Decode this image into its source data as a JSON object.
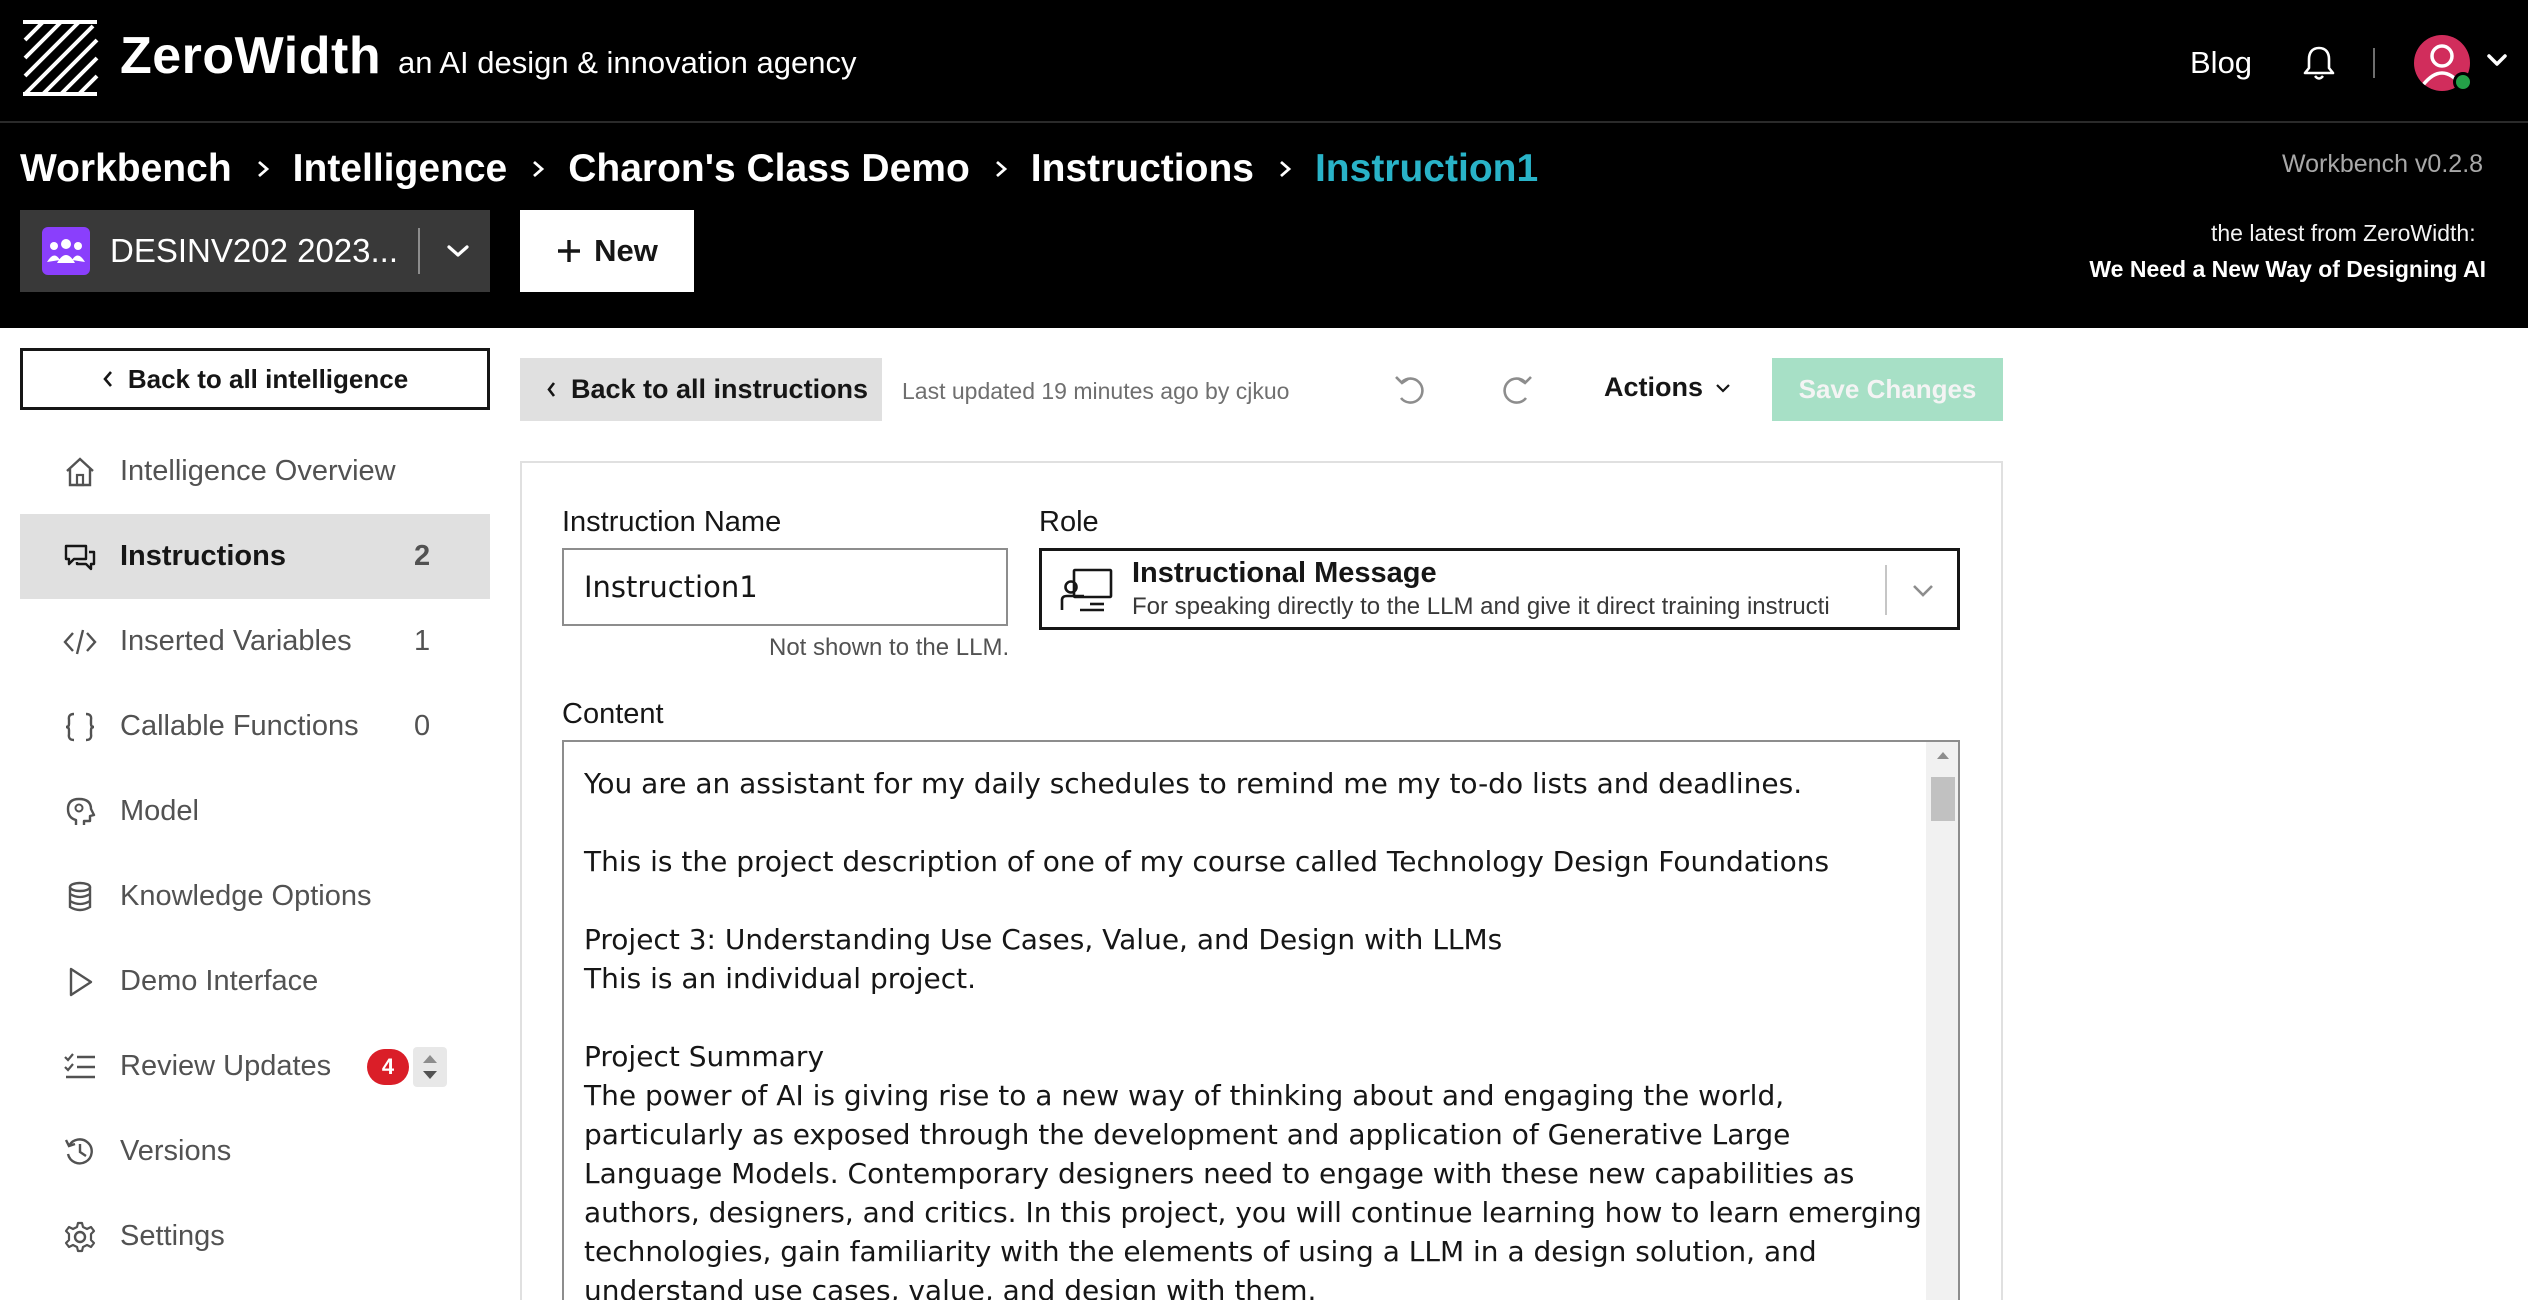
{
  "header": {
    "brand_name": "ZeroWidth",
    "tagline": "an AI design & innovation agency",
    "blog_label": "Blog",
    "icons": {
      "logo": "zerowidth-logo-icon",
      "notifications": "bell-icon",
      "user": "user-avatar-icon",
      "menu": "chevron-down-icon"
    }
  },
  "breadcrumb": {
    "items": [
      "Workbench",
      "Intelligence",
      "Charon's Class Demo",
      "Instructions",
      "Instruction1"
    ]
  },
  "version_label": "Workbench v0.2.8",
  "latest": {
    "label": "the latest from ZeroWidth:",
    "article": "We Need a New Way of Designing AI"
  },
  "org_selector": {
    "label": "DESINV202 2023..."
  },
  "new_button": {
    "label": "New"
  },
  "sidebar": {
    "back_label": "Back to all intelligence",
    "items": [
      {
        "label": "Intelligence Overview",
        "icon": "home-icon",
        "count": null
      },
      {
        "label": "Instructions",
        "icon": "chat-icon",
        "count": "2",
        "active": true
      },
      {
        "label": "Inserted Variables",
        "icon": "code-icon",
        "count": "1"
      },
      {
        "label": "Callable Functions",
        "icon": "braces-icon",
        "count": "0"
      },
      {
        "label": "Model",
        "icon": "brain-icon",
        "count": null
      },
      {
        "label": "Knowledge Options",
        "icon": "database-icon",
        "count": null
      },
      {
        "label": "Demo Interface",
        "icon": "play-icon",
        "count": null
      },
      {
        "label": "Review Updates",
        "icon": "checklist-icon",
        "badge": "4"
      },
      {
        "label": "Versions",
        "icon": "history-icon",
        "count": null
      },
      {
        "label": "Settings",
        "icon": "gear-icon",
        "count": null
      }
    ]
  },
  "toolbar": {
    "back_label": "Back to all instructions",
    "last_updated": "Last updated 19 minutes ago by cjkuo",
    "actions_label": "Actions",
    "save_label": "Save Changes"
  },
  "editor": {
    "name_label": "Instruction Name",
    "name_value": "Instruction1",
    "name_hint": "Not shown to the LLM.",
    "role_label": "Role",
    "role_title": "Instructional Message",
    "role_description": "For speaking directly to the LLM and give it direct training instructi",
    "content_label": "Content",
    "content_text": "You are an assistant for my daily schedules to remind me my to-do lists and deadlines.\n\nThis is the project description of one of my course called Technology Design Foundations\n\nProject 3: Understanding Use Cases, Value, and Design with LLMs\nThis is an individual project.\n\nProject Summary\nThe power of AI is giving rise to a new way of thinking about and engaging the world, particularly as exposed through the development and application of Generative Large Language Models. Contemporary designers need to engage with these new capabilities as authors, designers, and critics. In this project, you will continue learning how to learn emerging technologies, gain familiarity with the elements of using a LLM in a design solution, and understand use cases, value, and design with them."
  },
  "colors": {
    "header_bg": "#000000",
    "current_crumb": "#29b3c8",
    "save_disabled": "#a7e0c6",
    "badge": "#da1e28",
    "org_icon": "#8a3ffc",
    "avatar": "#d12d5c",
    "online": "#24a148"
  }
}
